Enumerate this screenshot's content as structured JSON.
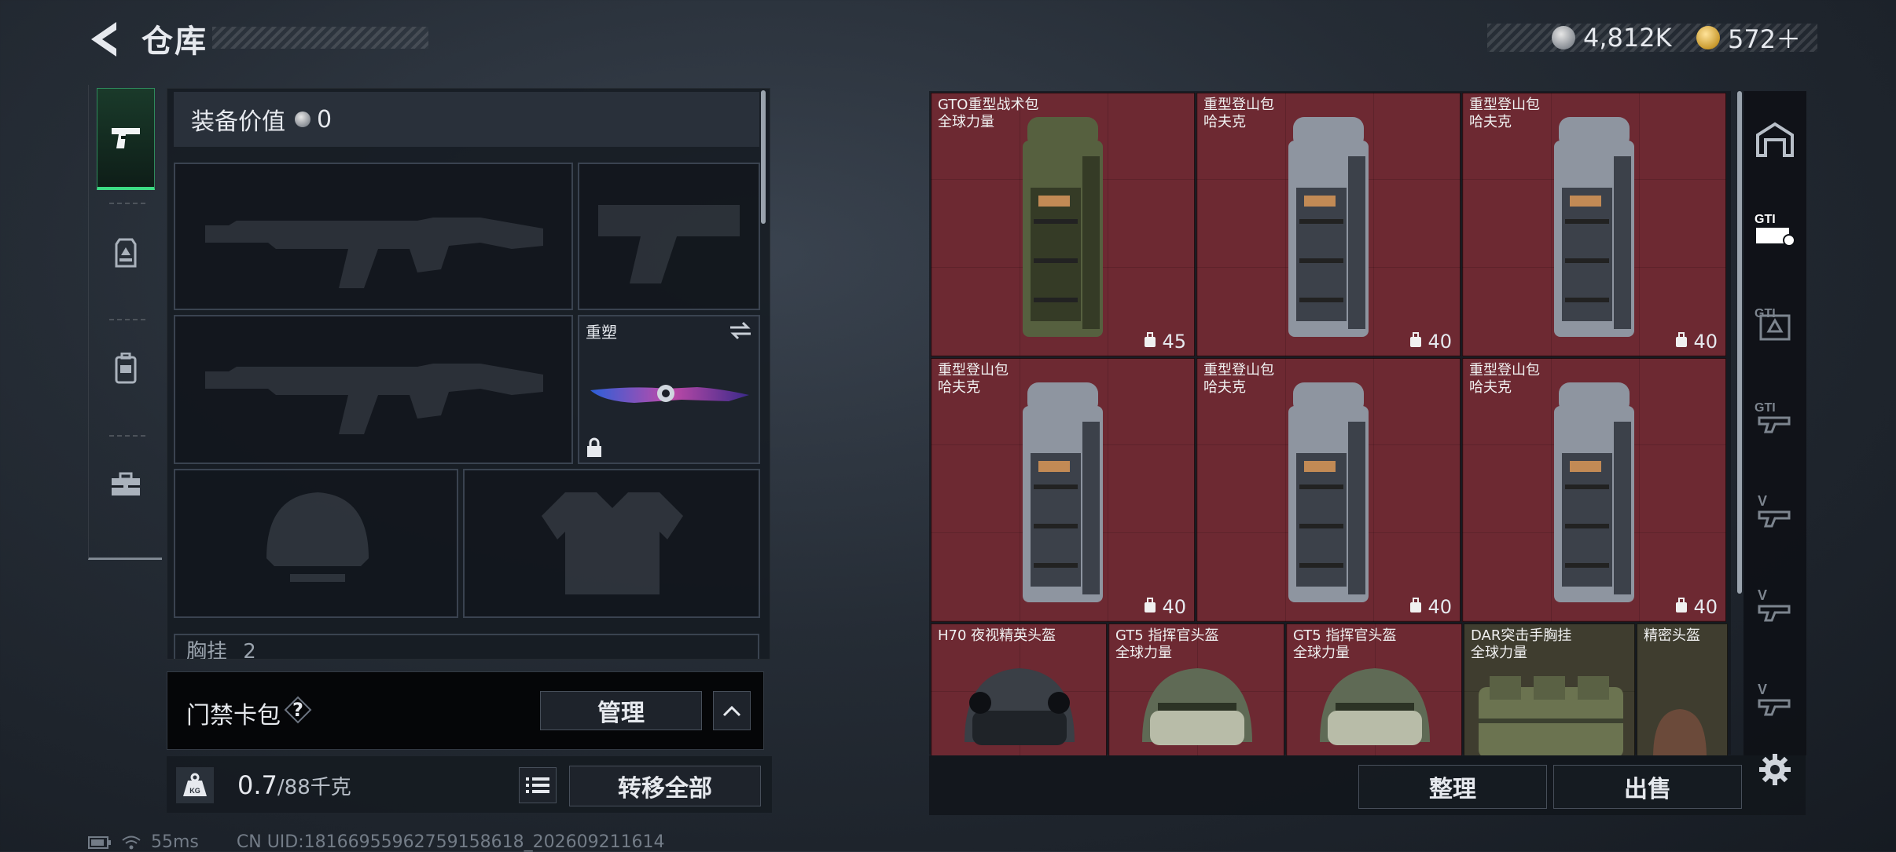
{
  "header": {
    "title": "仓库",
    "currency_1": "4,812K",
    "currency_2": "572＋"
  },
  "loadout": {
    "equip_value_label": "装备价值",
    "equip_value": "0",
    "knife_name": "重塑",
    "chest_label": "胸挂",
    "chest_count": "2"
  },
  "keycard": {
    "label": "门禁卡包",
    "help": "?",
    "manage": "管理"
  },
  "carry": {
    "current": "0.7",
    "max": "/88千克",
    "transfer_all": "转移全部"
  },
  "status": {
    "ping": "55ms",
    "uid": "CN UID:18166955962759158618_202609211614"
  },
  "inventory": {
    "items": [
      {
        "line1": "GTO重型战术包",
        "line2": "全球力量",
        "cap": "45",
        "pack": "olive"
      },
      {
        "line1": "重型登山包",
        "line2": "哈夫克",
        "cap": "40",
        "pack": "camo"
      },
      {
        "line1": "重型登山包",
        "line2": "哈夫克",
        "cap": "40",
        "pack": "camo"
      },
      {
        "line1": "重型登山包",
        "line2": "哈夫克",
        "cap": "40",
        "pack": "camo"
      },
      {
        "line1": "重型登山包",
        "line2": "哈夫克",
        "cap": "40",
        "pack": "camo"
      },
      {
        "line1": "重型登山包",
        "line2": "哈夫克",
        "cap": "40",
        "pack": "camo"
      }
    ],
    "helmets": [
      {
        "line1": "H70 夜视精英头盔",
        "line2": ""
      },
      {
        "line1": "GT5 指挥官头盔",
        "line2": "全球力量"
      },
      {
        "line1": "GT5 指挥官头盔",
        "line2": "全球力量"
      }
    ],
    "vest": {
      "line1": "DAR突击手胸挂",
      "line2": "全球力量"
    },
    "precision_helmet": {
      "line1": "精密头盔"
    },
    "sort": "整理",
    "sell": "出售"
  },
  "colors": {
    "item_red": "#6d2932",
    "panel_dark": "#161b22",
    "accent_green": "#3ddc84"
  },
  "icons": {
    "left_tabs": [
      "pistol-icon",
      "vest-icon",
      "backpack-icon",
      "toolbox-icon"
    ],
    "right_sidebar": [
      "garage-icon",
      "gti-container-icon",
      "gti-box-icon",
      "gti-gun-icon",
      "v-gun-icon",
      "v-gun-icon",
      "v-gun-icon"
    ]
  }
}
